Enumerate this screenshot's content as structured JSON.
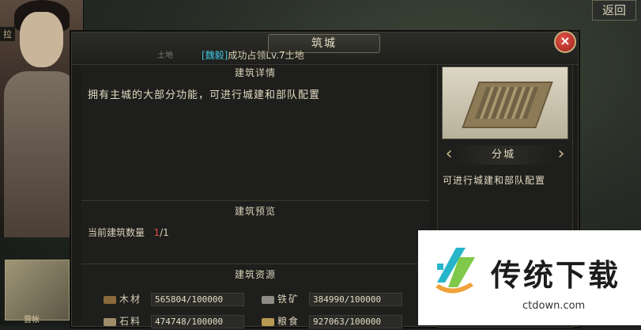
{
  "background": {
    "top_left_tag": "拉",
    "back_label": "返回",
    "bottom_thumb_label": "营帐"
  },
  "dialog": {
    "title": "筑城",
    "faint_left": "土地",
    "occupy_tag": "[魏毅]",
    "occupy_text": "成功占领Lv.7土地",
    "close_symbol": "×",
    "details_title": "建筑详情",
    "details_text": "拥有主城的大部分功能，可进行城建和部队配置",
    "preview_title": "建筑预览",
    "count_label": "当前建筑数量",
    "count_current": "1",
    "count_total": "/1",
    "resources_title": "建筑资源",
    "resources": [
      {
        "name": "木材",
        "value": "565804/100000",
        "icon": "wood-icon"
      },
      {
        "name": "铁矿",
        "value": "384990/100000",
        "icon": "iron-icon"
      },
      {
        "name": "石料",
        "value": "474748/100000",
        "icon": "stone-icon"
      },
      {
        "name": "粮食",
        "value": "927063/100000",
        "icon": "grain-icon"
      }
    ],
    "city": {
      "name": "分城",
      "prev_symbol": "‹",
      "next_symbol": "›",
      "description": "可进行城建和部队配置"
    }
  },
  "watermark": {
    "brand": "传统下载",
    "url": "ctdown.com"
  },
  "colors": {
    "accent_red": "#df4b3a",
    "tag_cyan": "#3fc4de"
  }
}
